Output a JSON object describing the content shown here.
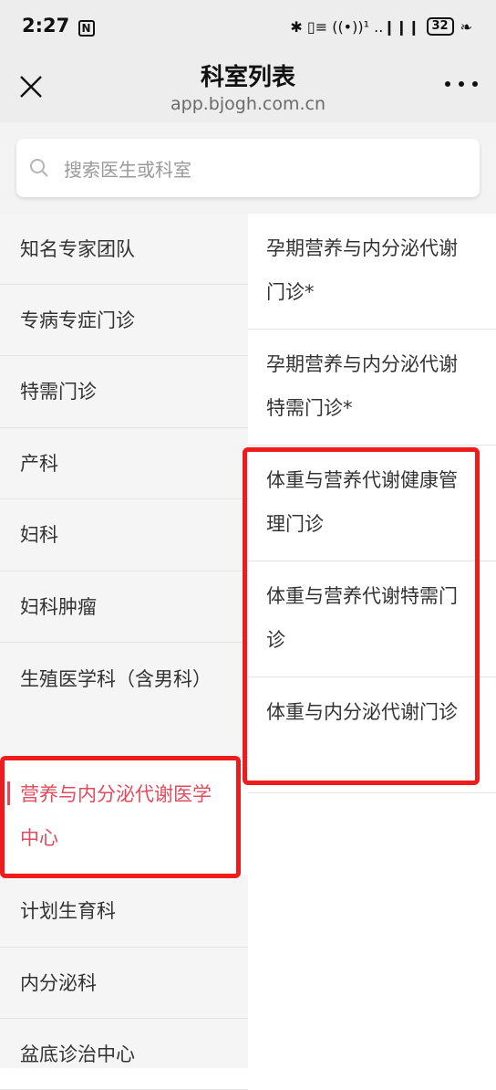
{
  "status_bar": {
    "time": "2:27",
    "notif_glyph": "N",
    "signal_text": "✱ ▯≡ ((•))¹ ..❙❙❙",
    "battery": "32",
    "leaf": "❧"
  },
  "nav": {
    "title": "科室列表",
    "subtitle": "app.bjogh.com.cn",
    "close_icon": "close-icon",
    "more_icon": "more-icon"
  },
  "search": {
    "placeholder": "搜索医生或科室",
    "icon": "search-icon"
  },
  "left_menu": {
    "items": [
      {
        "label": "知名专家团队"
      },
      {
        "label": "专病专症门诊"
      },
      {
        "label": "特需门诊"
      },
      {
        "label": "产科"
      },
      {
        "label": "妇科"
      },
      {
        "label": "妇科肿瘤"
      },
      {
        "label": "生殖医学科（含男科）"
      },
      {
        "label": "营养与内分泌代谢医学中心",
        "active": true
      },
      {
        "label": "计划生育科"
      },
      {
        "label": "内分泌科"
      },
      {
        "label": "盆底诊治中心"
      }
    ]
  },
  "right_menu": {
    "items": [
      {
        "label": "孕期营养与内分泌代谢门诊*"
      },
      {
        "label": "孕期营养与内分泌代谢特需门诊*"
      },
      {
        "label": "体重与营养代谢健康管理门诊"
      },
      {
        "label": "体重与营养代谢特需门诊"
      },
      {
        "label": "体重与内分泌代谢门诊"
      }
    ]
  },
  "colors": {
    "highlight": "#ee1c1c",
    "active_text": "#e04b5d"
  }
}
